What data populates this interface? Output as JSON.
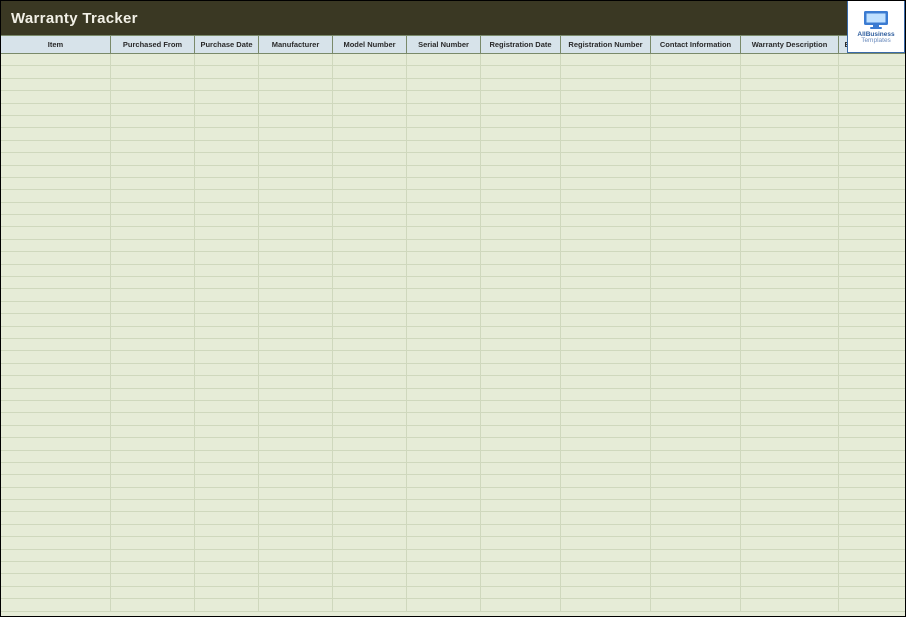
{
  "title": "Warranty Tracker",
  "logo": {
    "top": "AllBusiness",
    "bottom": "Templates"
  },
  "columns": [
    "Item",
    "Purchased From",
    "Purchase Date",
    "Manufacturer",
    "Model Number",
    "Serial Number",
    "Registration Date",
    "Registration Number",
    "Contact Information",
    "Warranty Description",
    "Expiration Date"
  ],
  "row_count": 45
}
